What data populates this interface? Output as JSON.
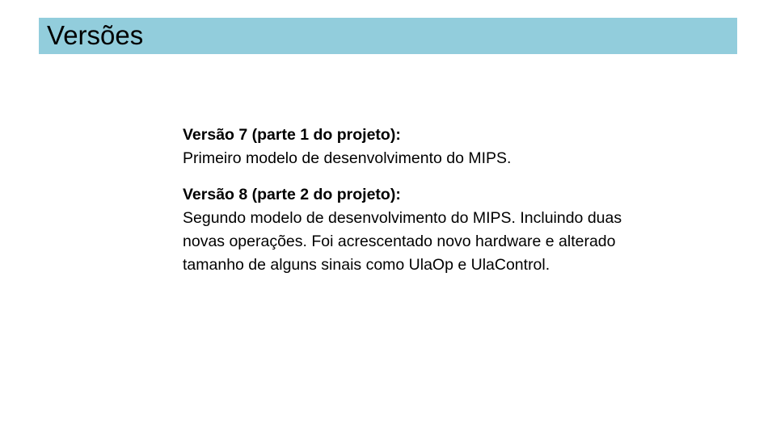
{
  "slide": {
    "title": "Versões",
    "sections": [
      {
        "heading": "Versão 7 (parte 1 do projeto):",
        "body": "Primeiro modelo de desenvolvimento do MIPS."
      },
      {
        "heading": "Versão 8 (parte 2 do projeto):",
        "body": "Segundo modelo de desenvolvimento do MIPS. Incluindo duas novas operações. Foi acrescentado novo hardware e alterado tamanho de alguns sinais como UlaOp e UlaControl."
      }
    ]
  },
  "colors": {
    "title_bar_background": "#92cddc",
    "text": "#000000",
    "page_background": "#ffffff"
  }
}
